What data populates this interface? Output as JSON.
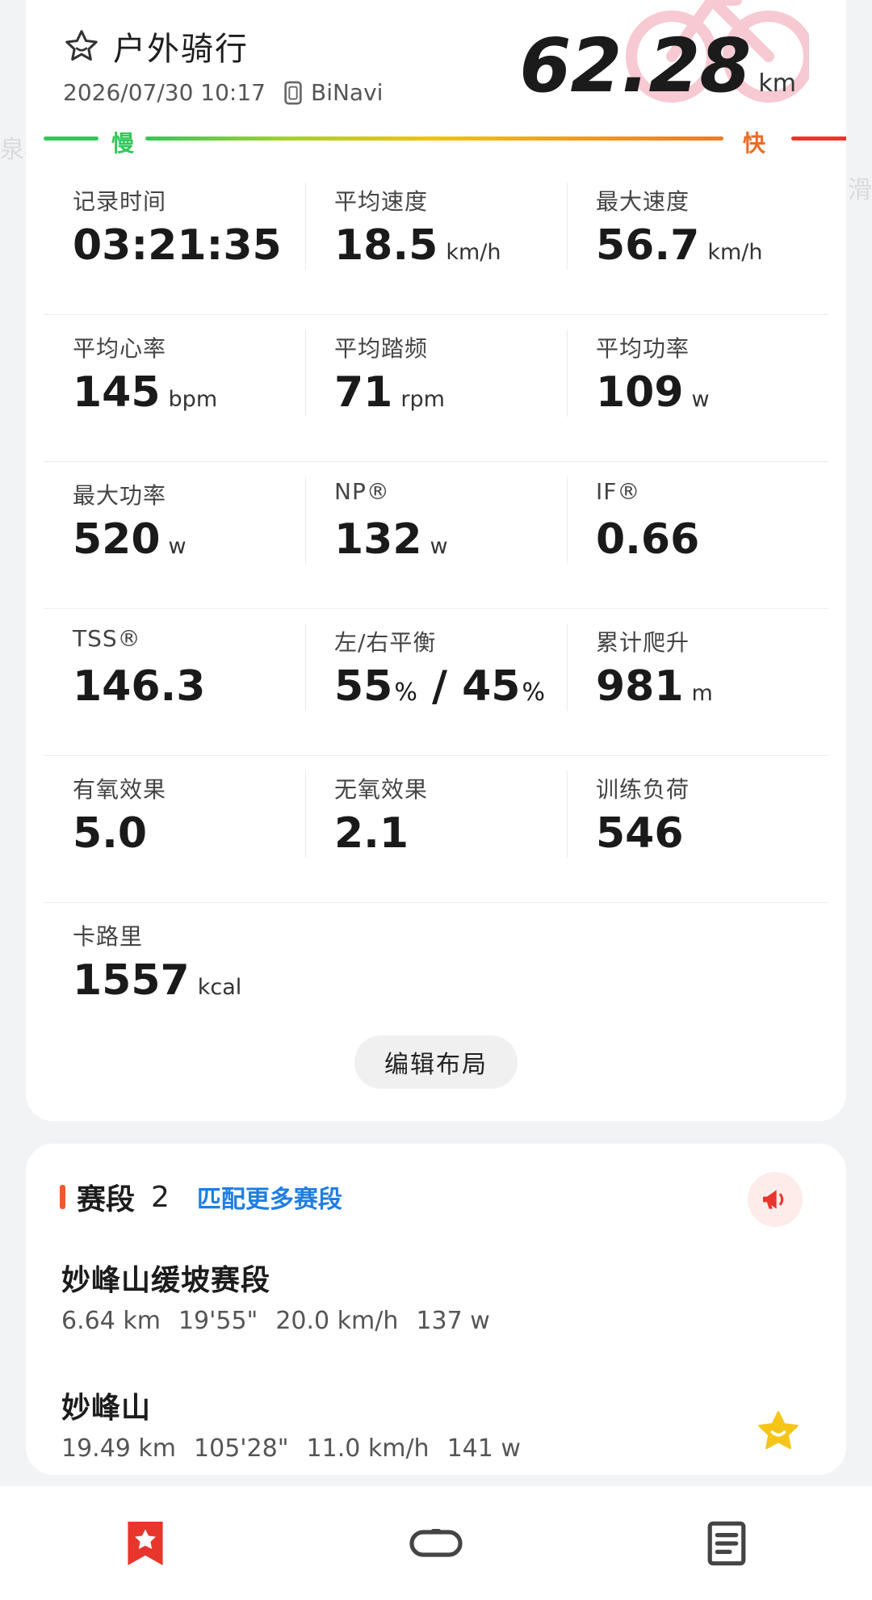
{
  "header": {
    "title": "户外骑行",
    "datetime": "2026/07/30 10:17",
    "device": "BiNavi",
    "distance": "62.28",
    "distance_unit": "km"
  },
  "speed_scale": {
    "slow_label": "慢",
    "fast_label": "快"
  },
  "metrics": [
    [
      {
        "label": "记录时间",
        "value": "03:21:35",
        "unit": ""
      },
      {
        "label": "平均速度",
        "value": "18.5",
        "unit": "km/h"
      },
      {
        "label": "最大速度",
        "value": "56.7",
        "unit": "km/h"
      }
    ],
    [
      {
        "label": "平均心率",
        "value": "145",
        "unit": "bpm"
      },
      {
        "label": "平均踏频",
        "value": "71",
        "unit": "rpm"
      },
      {
        "label": "平均功率",
        "value": "109",
        "unit": "w"
      }
    ],
    [
      {
        "label": "最大功率",
        "value": "520",
        "unit": "w"
      },
      {
        "label": "NP®",
        "value": "132",
        "unit": "w"
      },
      {
        "label": "IF®",
        "value": "0.66",
        "unit": ""
      }
    ],
    [
      {
        "label": "TSS®",
        "value": "146.3",
        "unit": ""
      },
      {
        "label": "左/右平衡",
        "left": "55",
        "right": "45",
        "pct": "%",
        "sep": "/"
      },
      {
        "label": "累计爬升",
        "value": "981",
        "unit": "m"
      }
    ],
    [
      {
        "label": "有氧效果",
        "value": "5.0",
        "unit": ""
      },
      {
        "label": "无氧效果",
        "value": "2.1",
        "unit": ""
      },
      {
        "label": "训练负荷",
        "value": "546",
        "unit": ""
      }
    ],
    [
      {
        "label": "卡路里",
        "value": "1557",
        "unit": "kcal"
      }
    ]
  ],
  "edit_layout_label": "编辑布局",
  "segments": {
    "title": "赛段",
    "count": "2",
    "match_more_label": "匹配更多赛段",
    "items": [
      {
        "name": "妙峰山缓坡赛段",
        "distance": "6.64 km",
        "time": "19'55\"",
        "speed": "20.0 km/h",
        "power": "137 w",
        "favorite": false
      },
      {
        "name": "妙峰山",
        "distance": "19.49 km",
        "time": "105'28\"",
        "speed": "11.0 km/h",
        "power": "141 w",
        "favorite": true
      }
    ]
  },
  "colors": {
    "accent_orange": "#ee5a2c",
    "link_blue": "#1f7ee0",
    "nav_active_red": "#e8362d",
    "star_yellow": "#f5c518"
  }
}
